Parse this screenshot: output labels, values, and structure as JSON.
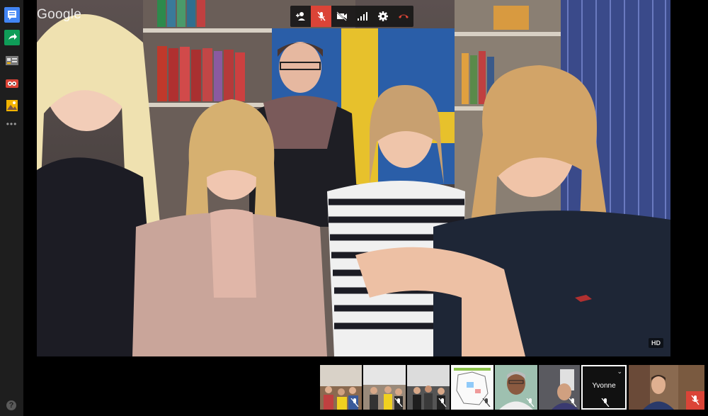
{
  "rail": {
    "items": [
      {
        "icon": "chat-icon",
        "color": "#4285f4"
      },
      {
        "icon": "share-screen-icon",
        "color": "#0f9d58"
      },
      {
        "icon": "apps-icon",
        "color": "#9e9e9e"
      },
      {
        "icon": "effects-icon",
        "color": "#db4437"
      },
      {
        "icon": "photo-icon",
        "color": "#f4b400"
      }
    ],
    "more_label": "•••",
    "help_label": "?"
  },
  "main_video": {
    "logo": "Google",
    "quality_badge": "HD"
  },
  "toolbar": {
    "buttons": [
      {
        "icon": "add-person-icon"
      },
      {
        "icon": "mic-muted-icon",
        "active": true
      },
      {
        "icon": "camera-off-icon"
      },
      {
        "icon": "signal-icon"
      },
      {
        "icon": "settings-icon"
      },
      {
        "icon": "hang-up-icon",
        "color": "#db4437"
      }
    ]
  },
  "filmstrip": {
    "participants": [
      {
        "name": "",
        "muted": true
      },
      {
        "name": "",
        "muted": true
      },
      {
        "name": "",
        "muted": true
      },
      {
        "name": "",
        "muted": true
      },
      {
        "name": "",
        "muted": true
      },
      {
        "name": "Yvonne",
        "muted": true,
        "selected": true,
        "menu": "⌄"
      },
      {
        "name": "",
        "muted": true,
        "self": true
      }
    ]
  },
  "colors": {
    "mute_red": "#db4437",
    "rail_bg": "#1e1e1e"
  }
}
